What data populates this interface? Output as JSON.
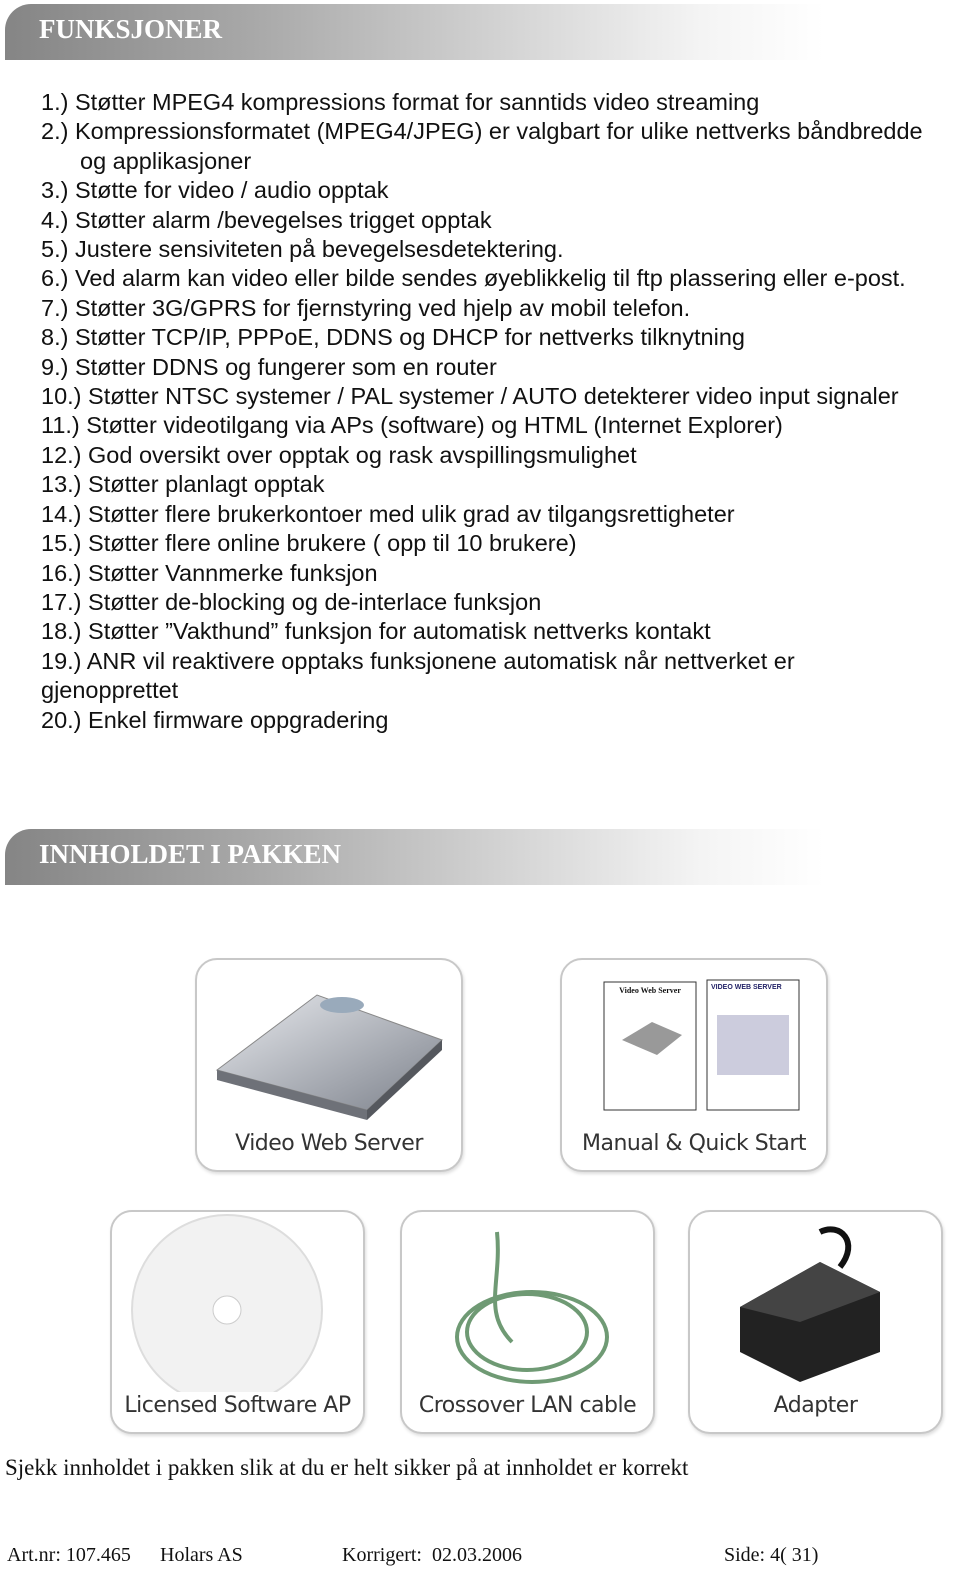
{
  "sections": {
    "features_title": "FUNKSJONER",
    "package_title": "INNHOLDET I PAKKEN"
  },
  "features": [
    "1.) Støtter MPEG4 kompressions format for sanntids video streaming",
    "2.) Kompressionsformatet (MPEG4/JPEG) er valgbart for ulike nettverks båndbredde og applikasjoner",
    "3.) Støtte for video / audio opptak",
    "4.) Støtter alarm /bevegelses trigget opptak",
    "5.) Justere sensiviteten på bevegelsesdetektering.",
    "6.) Ved alarm kan video eller bilde sendes øyeblikkelig til ftp plassering eller e-post.",
    "7.) Støtter 3G/GPRS  for fjernstyring ved hjelp av mobil telefon.",
    "8.) Støtter TCP/IP, PPPoE, DDNS og DHCP for nettverks tilknytning",
    "9.) Støtter DDNS og fungerer som en router",
    "10.) Støtter NTSC systemer / PAL systemer / AUTO detekterer video input signaler",
    "11.) Støtter videotilgang via APs (software) og HTML (Internet Explorer)",
    "12.) God oversikt over opptak og rask avspillingsmulighet",
    "13.) Støtter planlagt opptak",
    "14.) Støtter flere brukerkontoer med ulik grad av tilgangsrettigheter",
    "15.) Støtter flere online brukere ( opp til 10 brukere)",
    "16.) Støtter Vannmerke funksjon",
    "17.) Støtter de-blocking  og de-interlace funksjon",
    "18.) Støtter ”Vakthund” funksjon for automatisk nettverks kontakt",
    "19.) ANR vil reaktivere opptaks funksjonene automatisk når nettverket er gjenopprettet",
    "20.) Enkel firmware oppgradering"
  ],
  "package": {
    "items": [
      "Video Web Server",
      "Manual & Quick Start",
      "Licensed Software AP",
      "Crossover LAN cable",
      "Adapter"
    ],
    "manual_titles": [
      "Video Web Server",
      "VIDEO WEB SERVER"
    ],
    "note": "Sjekk innholdet i pakken slik at du er helt sikker på at innholdet er korrekt"
  },
  "footer": {
    "artnr": "Art.nr: 107.465",
    "company": "Holars AS",
    "corrected": "Korrigert:  02.03.2006",
    "page": "Side: 4( 31)"
  }
}
